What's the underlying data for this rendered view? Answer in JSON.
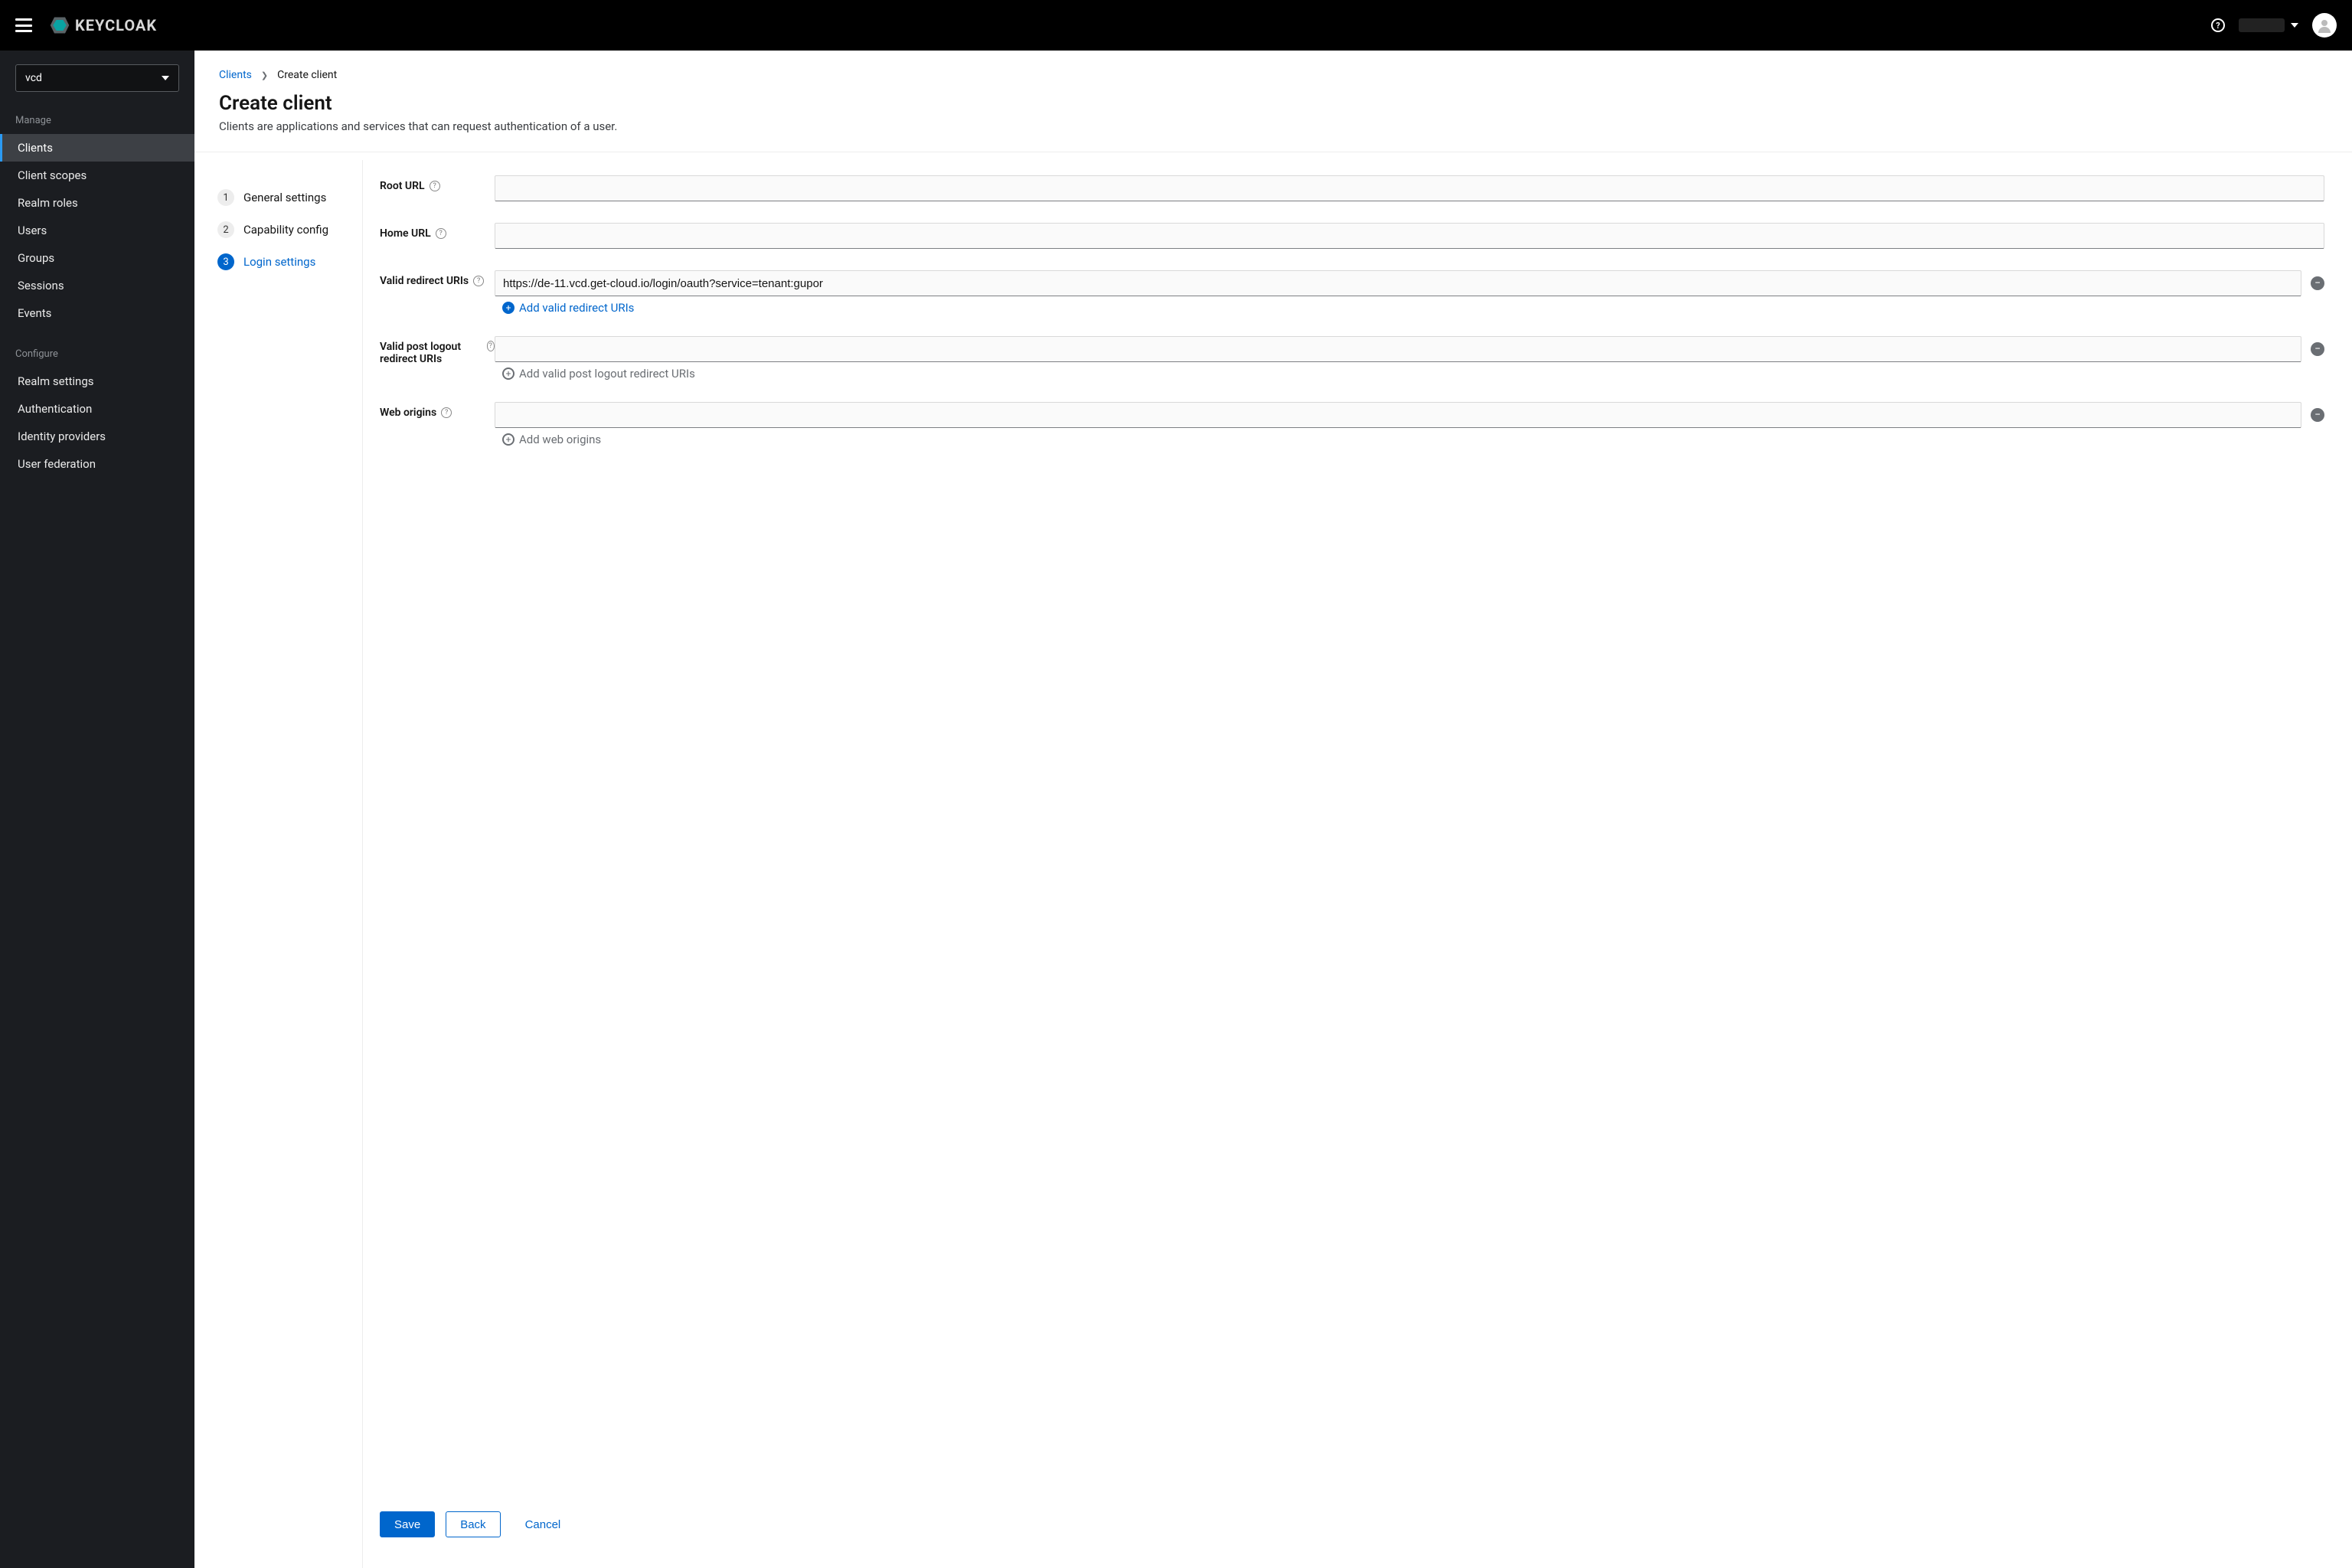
{
  "brand": {
    "name": "KEYCLOAK"
  },
  "realm": {
    "selected": "vcd"
  },
  "sidebar": {
    "manage_label": "Manage",
    "configure_label": "Configure",
    "manage": [
      {
        "label": "Clients",
        "active": true
      },
      {
        "label": "Client scopes"
      },
      {
        "label": "Realm roles"
      },
      {
        "label": "Users"
      },
      {
        "label": "Groups"
      },
      {
        "label": "Sessions"
      },
      {
        "label": "Events"
      }
    ],
    "configure": [
      {
        "label": "Realm settings"
      },
      {
        "label": "Authentication"
      },
      {
        "label": "Identity providers"
      },
      {
        "label": "User federation"
      }
    ]
  },
  "breadcrumb": {
    "parent": "Clients",
    "current": "Create client"
  },
  "page": {
    "title": "Create client",
    "description": "Clients are applications and services that can request authentication of a user."
  },
  "wizard": {
    "steps": [
      {
        "num": "1",
        "label": "General settings"
      },
      {
        "num": "2",
        "label": "Capability config"
      },
      {
        "num": "3",
        "label": "Login settings",
        "active": true
      }
    ]
  },
  "form": {
    "root_url": {
      "label": "Root URL",
      "value": ""
    },
    "home_url": {
      "label": "Home URL",
      "value": ""
    },
    "valid_redirect_uris": {
      "label": "Valid redirect URIs",
      "values": [
        "https://de-11.vcd.get-cloud.io/login/oauth?service=tenant:gupor"
      ],
      "add_label": "Add valid redirect URIs"
    },
    "valid_post_logout_redirect_uris": {
      "label": "Valid post logout redirect URIs",
      "values": [
        ""
      ],
      "add_label": "Add valid post logout redirect URIs"
    },
    "web_origins": {
      "label": "Web origins",
      "values": [
        ""
      ],
      "add_label": "Add web origins"
    }
  },
  "footer": {
    "save": "Save",
    "back": "Back",
    "cancel": "Cancel"
  }
}
